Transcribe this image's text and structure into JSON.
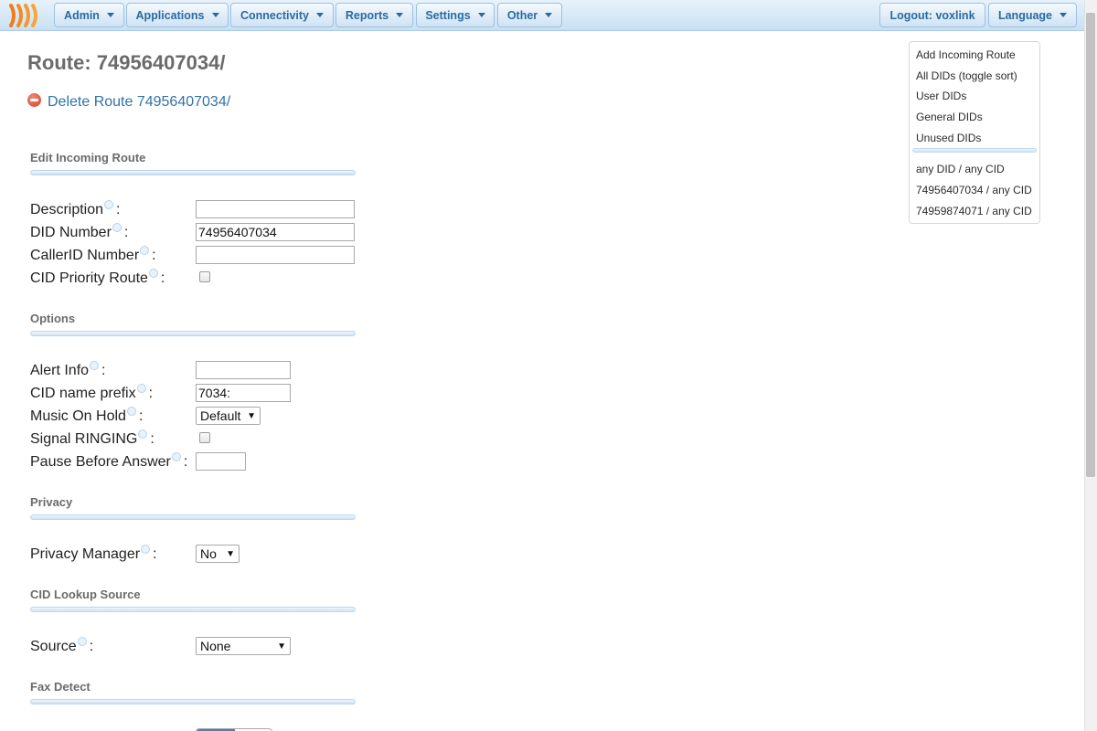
{
  "nav": {
    "items": [
      {
        "label": "Admin"
      },
      {
        "label": "Applications"
      },
      {
        "label": "Connectivity"
      },
      {
        "label": "Reports"
      },
      {
        "label": "Settings"
      },
      {
        "label": "Other"
      }
    ],
    "logout_label": "Logout: voxlink",
    "language_label": "Language"
  },
  "page": {
    "title": "Route: 74956407034/",
    "delete_label": "Delete Route 74956407034/"
  },
  "sections": {
    "edit": "Edit Incoming Route",
    "options": "Options",
    "privacy": "Privacy",
    "cid_lookup": "CID Lookup Source",
    "fax": "Fax Detect"
  },
  "fields": {
    "description": {
      "label": "Description",
      "value": ""
    },
    "did_number": {
      "label": "DID Number",
      "value": "74956407034"
    },
    "callerid_number": {
      "label": "CallerID Number",
      "value": ""
    },
    "cid_priority": {
      "label": "CID Priority Route",
      "checked": false
    },
    "alert_info": {
      "label": "Alert Info",
      "value": ""
    },
    "cid_prefix": {
      "label": "CID name prefix",
      "value": "7034:"
    },
    "moh": {
      "label": "Music On Hold",
      "value": "Default"
    },
    "signal_ringing": {
      "label": "Signal RINGING",
      "checked": false
    },
    "pause": {
      "label": "Pause Before Answer",
      "value": ""
    },
    "privacy_manager": {
      "label": "Privacy Manager",
      "value": "No"
    },
    "source": {
      "label": "Source",
      "value": "None"
    }
  },
  "sidemenu": {
    "items": [
      "Add Incoming Route",
      "All DIDs (toggle sort)",
      "User DIDs",
      "General DIDs",
      "Unused DIDs"
    ],
    "routes": [
      "any DID / any CID",
      "74956407034 / any CID",
      "74959874071 / any CID"
    ]
  },
  "colors": {
    "nav_text": "#2a6aa0",
    "link": "#2f73a8",
    "heading": "#6b6b6b",
    "delete_red": "#d2402c"
  }
}
